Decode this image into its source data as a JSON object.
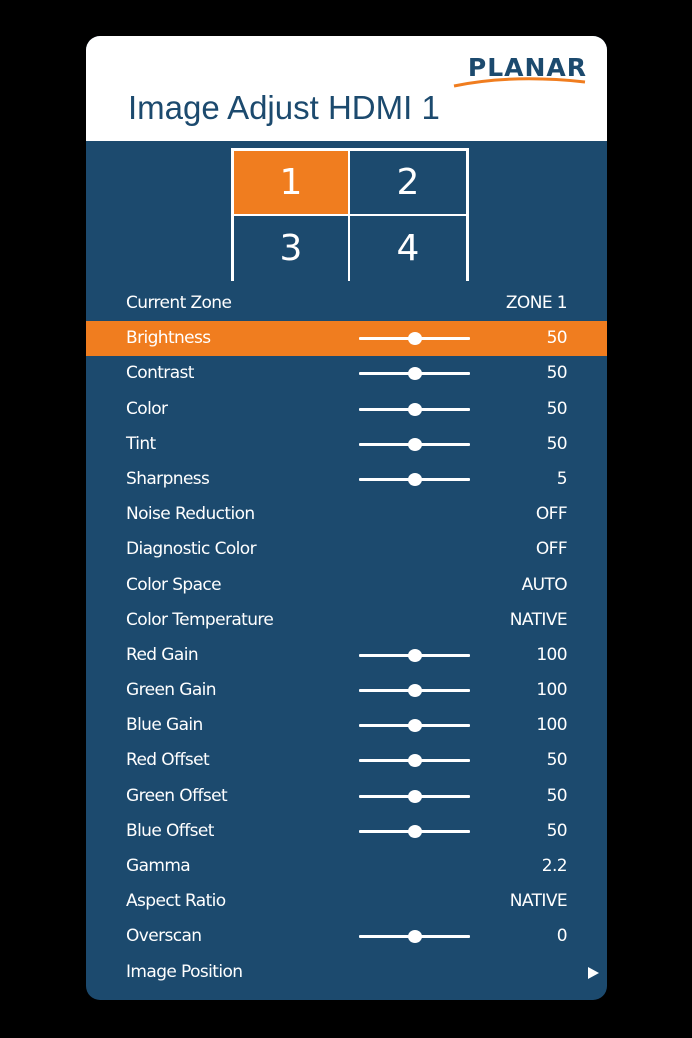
{
  "header": {
    "brand": "PLANAR",
    "title": "Image Adjust HDMI 1"
  },
  "zones": [
    {
      "label": "1",
      "active": true
    },
    {
      "label": "2",
      "active": false
    },
    {
      "label": "3",
      "active": false
    },
    {
      "label": "4",
      "active": false
    }
  ],
  "colors": {
    "panel": "#1c4a6e",
    "accent": "#f07d1f",
    "header": "#ffffff"
  },
  "menu": [
    {
      "label": "Current Zone",
      "value": "ZONE 1"
    },
    {
      "label": "Brightness",
      "value": "50",
      "slider": 0.5,
      "selected": true
    },
    {
      "label": "Contrast",
      "value": "50",
      "slider": 0.5
    },
    {
      "label": "Color",
      "value": "50",
      "slider": 0.5
    },
    {
      "label": "Tint",
      "value": "50",
      "slider": 0.5
    },
    {
      "label": "Sharpness",
      "value": "5",
      "slider": 0.5
    },
    {
      "label": "Noise Reduction",
      "value": "OFF"
    },
    {
      "label": "Diagnostic Color",
      "value": "OFF"
    },
    {
      "label": "Color Space",
      "value": "AUTO"
    },
    {
      "label": "Color Temperature",
      "value": "NATIVE"
    },
    {
      "label": "Red Gain",
      "value": "100",
      "slider": 0.5
    },
    {
      "label": "Green Gain",
      "value": "100",
      "slider": 0.5
    },
    {
      "label": "Blue Gain",
      "value": "100",
      "slider": 0.5
    },
    {
      "label": "Red Offset",
      "value": "50",
      "slider": 0.5
    },
    {
      "label": "Green Offset",
      "value": "50",
      "slider": 0.5
    },
    {
      "label": "Blue Offset",
      "value": "50",
      "slider": 0.5
    },
    {
      "label": "Gamma",
      "value": "2.2"
    },
    {
      "label": "Aspect Ratio",
      "value": "NATIVE"
    },
    {
      "label": "Overscan",
      "value": "0",
      "slider": 0.5
    },
    {
      "label": "Image Position",
      "value": "",
      "submenu": true,
      "icon": "arrow-right-icon"
    }
  ]
}
